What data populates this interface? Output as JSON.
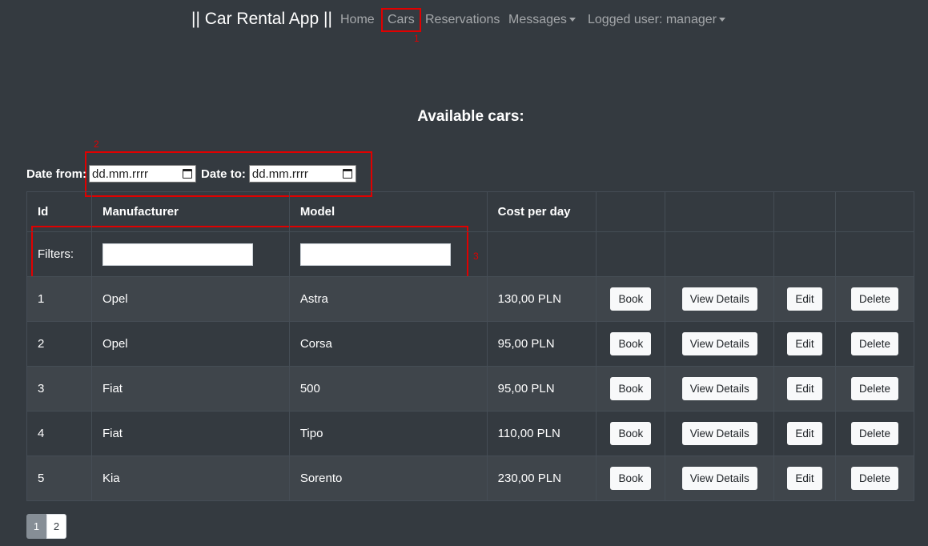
{
  "nav": {
    "brand": "|| Car Rental App ||",
    "home": "Home",
    "cars": "Cars",
    "reservations": "Reservations",
    "messages": "Messages",
    "logged_user": "Logged user: manager"
  },
  "annotations": [
    "1",
    "2",
    "3"
  ],
  "page_title": "Available cars:",
  "dates": {
    "from_label": "Date from:",
    "to_label": "Date to:",
    "from_value": "dd.mm.rrrr",
    "to_value": "dd.mm.rrrr"
  },
  "table": {
    "headers": [
      "Id",
      "Manufacturer",
      "Model",
      "Cost per day"
    ],
    "filters_label": "Filters:",
    "rows": [
      {
        "id": "1",
        "manufacturer": "Opel",
        "model": "Astra",
        "cost": "130,00 PLN"
      },
      {
        "id": "2",
        "manufacturer": "Opel",
        "model": "Corsa",
        "cost": "95,00 PLN"
      },
      {
        "id": "3",
        "manufacturer": "Fiat",
        "model": "500",
        "cost": "95,00 PLN"
      },
      {
        "id": "4",
        "manufacturer": "Fiat",
        "model": "Tipo",
        "cost": "110,00 PLN"
      },
      {
        "id": "5",
        "manufacturer": "Kia",
        "model": "Sorento",
        "cost": "230,00 PLN"
      }
    ],
    "actions": {
      "book": "Book",
      "view": "View Details",
      "edit": "Edit",
      "delete": "Delete"
    }
  },
  "pagination": [
    "1",
    "2"
  ],
  "colors": {
    "background": "#343a40",
    "annotation": "#e00000",
    "striped_row": "#3f454b"
  }
}
